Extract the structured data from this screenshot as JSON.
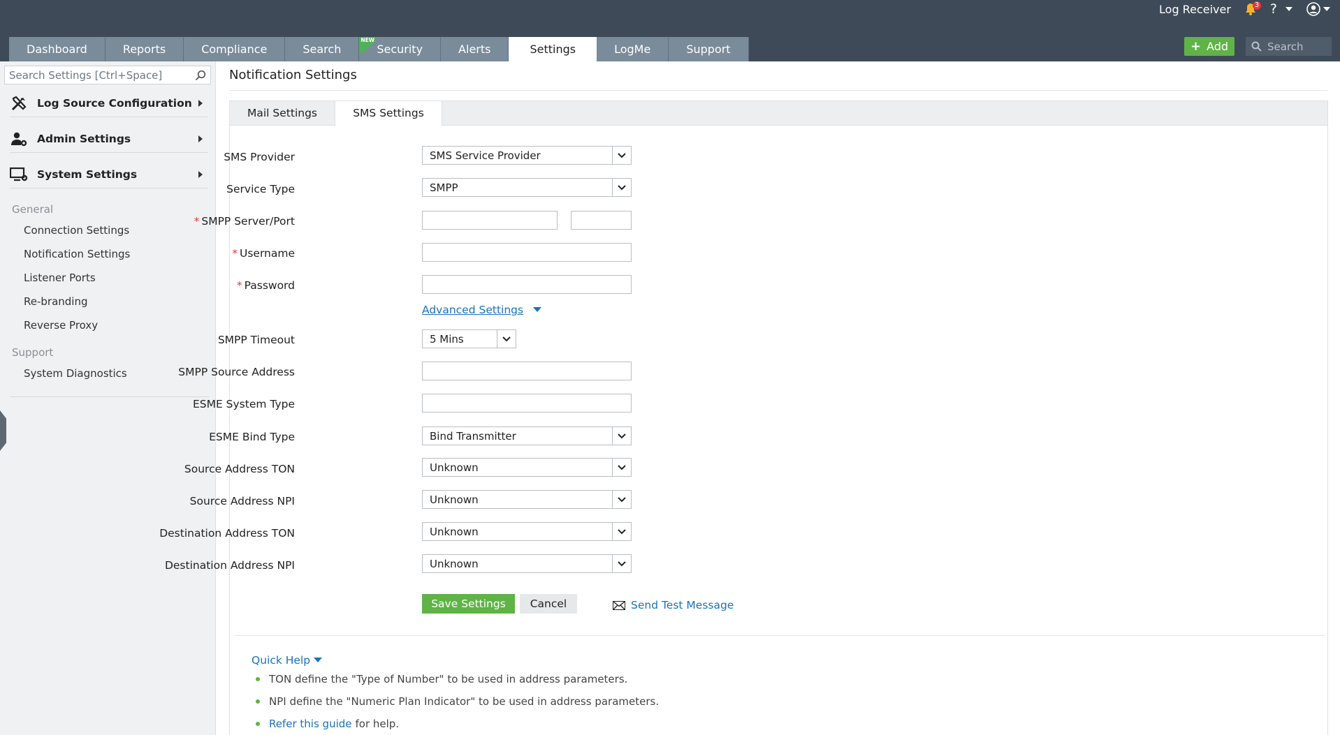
{
  "header": {
    "log_receiver": "Log Receiver",
    "notification_count": "3",
    "help_icon": "?",
    "tabs": [
      {
        "label": "Dashboard"
      },
      {
        "label": "Reports"
      },
      {
        "label": "Compliance"
      },
      {
        "label": "Search"
      },
      {
        "label": "Security",
        "new_tag": "NEW"
      },
      {
        "label": "Alerts"
      },
      {
        "label": "Settings",
        "active": true
      },
      {
        "label": "LogMe"
      },
      {
        "label": "Support"
      }
    ],
    "add_label": "Add",
    "search_placeholder": "Search"
  },
  "sidebar": {
    "search_placeholder": "Search Settings [Ctrl+Space]",
    "sections": [
      {
        "label": "Log Source Configuration",
        "icon": "tools-icon"
      },
      {
        "label": "Admin Settings",
        "icon": "admin-user-gear-icon"
      },
      {
        "label": "System Settings",
        "icon": "monitor-gear-icon"
      }
    ],
    "general_heading": "General",
    "general_links": [
      "Connection Settings",
      "Notification Settings",
      "Listener Ports",
      "Re-branding",
      "Reverse Proxy"
    ],
    "support_heading": "Support",
    "support_links": [
      "System Diagnostics"
    ]
  },
  "page": {
    "title": "Notification Settings",
    "tabs": [
      "Mail Settings",
      "SMS Settings"
    ],
    "active_tab": "SMS Settings"
  },
  "form": {
    "sms_provider": {
      "label": "SMS Provider",
      "value": "SMS Service Provider"
    },
    "service_type": {
      "label": "Service Type",
      "value": "SMPP"
    },
    "smpp_server_port": {
      "label": "SMPP Server/Port",
      "required": "*",
      "server_value": "",
      "port_value": ""
    },
    "username": {
      "label": "Username",
      "required": "*",
      "value": ""
    },
    "password": {
      "label": "Password",
      "required": "*",
      "value": ""
    },
    "advanced_settings": "Advanced Settings",
    "smpp_timeout": {
      "label": "SMPP Timeout",
      "value": "5 Mins"
    },
    "smpp_source_address": {
      "label": "SMPP Source Address",
      "value": ""
    },
    "esme_system_type": {
      "label": "ESME System Type",
      "value": ""
    },
    "esme_bind_type": {
      "label": "ESME Bind Type",
      "value": "Bind Transmitter"
    },
    "source_address_ton": {
      "label": "Source Address TON",
      "value": "Unknown"
    },
    "source_address_npi": {
      "label": "Source Address NPI",
      "value": "Unknown"
    },
    "destination_address_ton": {
      "label": "Destination Address TON",
      "value": "Unknown"
    },
    "destination_address_npi": {
      "label": "Destination Address NPI",
      "value": "Unknown"
    },
    "save_label": "Save Settings",
    "cancel_label": "Cancel",
    "send_test_label": "Send Test Message"
  },
  "quick_help": {
    "title": "Quick Help",
    "items": [
      "TON define the \"Type of Number\" to be used in address parameters.",
      "NPI define the \"Numeric Plan Indicator\" to be used in address parameters."
    ],
    "guide_link": "Refer this guide",
    "guide_suffix": "for help."
  },
  "colors": {
    "topbar": "#3e4a57",
    "tab": "#7a8b9a",
    "accent_green": "#5fb347",
    "link_blue": "#1a73b8",
    "required_red": "#e03a3a"
  }
}
